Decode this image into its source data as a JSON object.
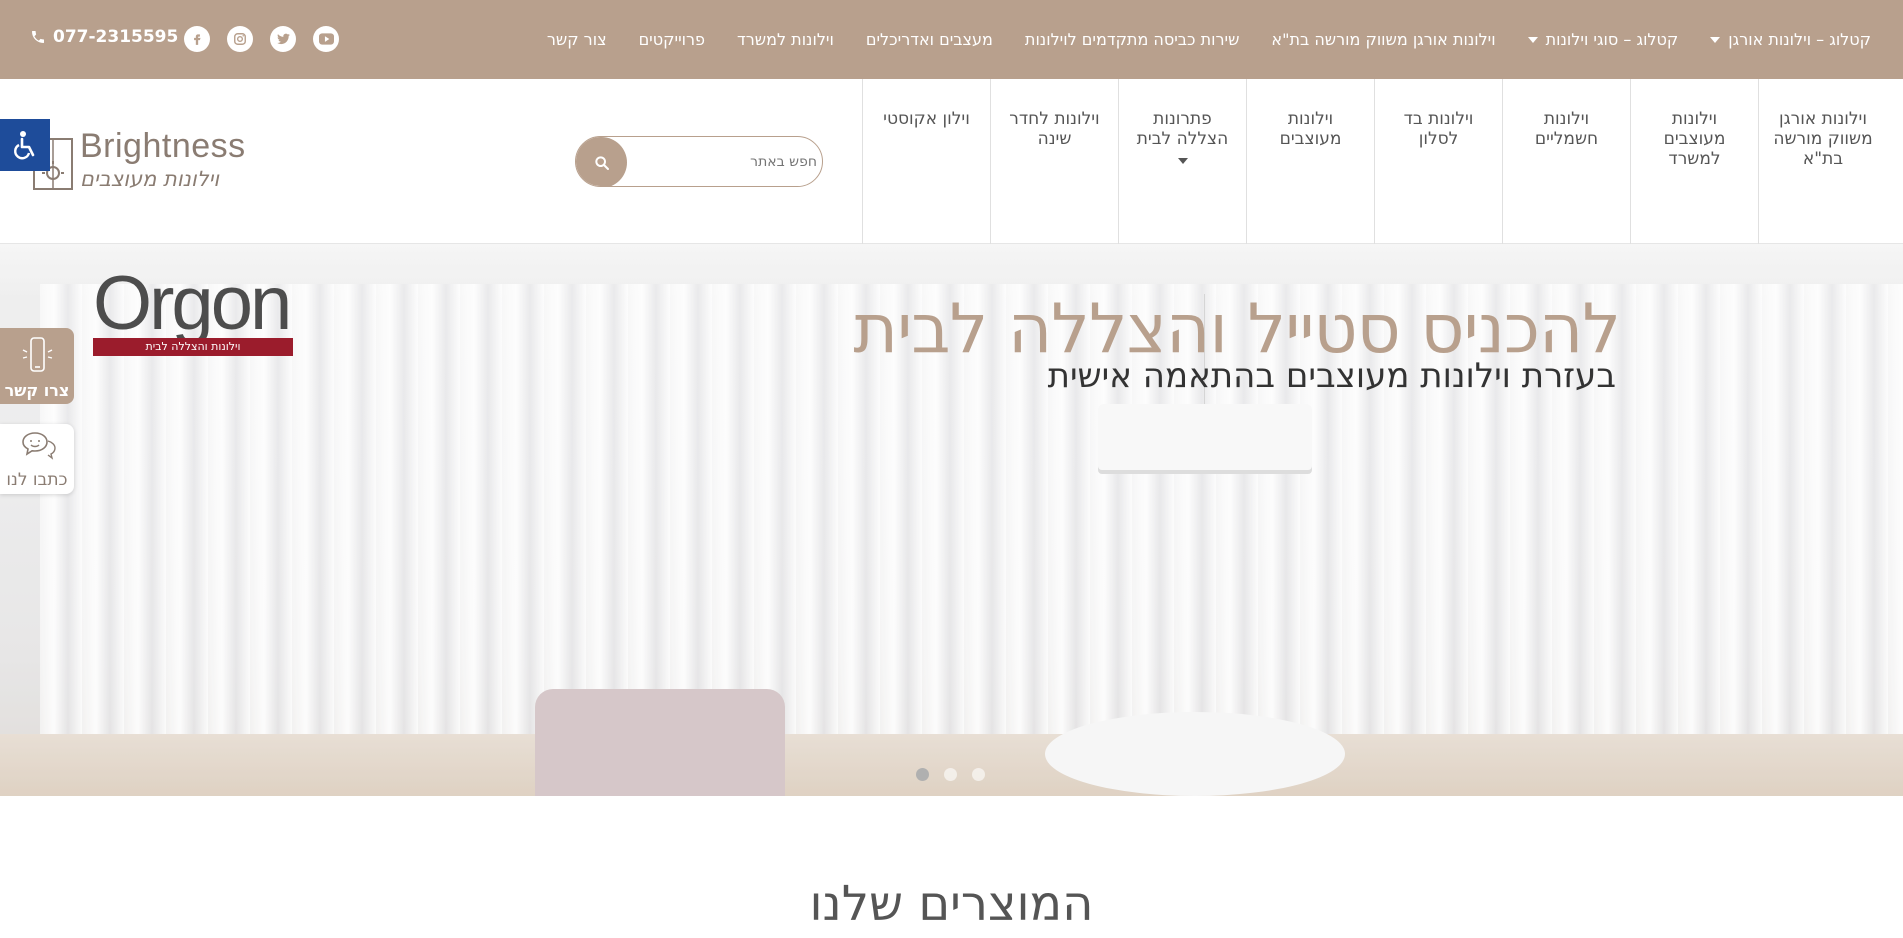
{
  "topbar": {
    "nav": [
      {
        "label": "קטלוג – וילונות אורגן",
        "has_dropdown": true
      },
      {
        "label": "קטלוג – סוגי וילונות",
        "has_dropdown": true
      },
      {
        "label": "וילונות אורגן משווק מורשה בת\"א",
        "has_dropdown": false
      },
      {
        "label": "שירות כביסה מתקדמים לוילונות",
        "has_dropdown": false
      },
      {
        "label": "מעצבים ואדריכלים",
        "has_dropdown": false
      },
      {
        "label": "וילונות למשרד",
        "has_dropdown": false
      },
      {
        "label": "פרוייקטים",
        "has_dropdown": false
      },
      {
        "label": "צור קשר",
        "has_dropdown": false
      }
    ],
    "social_icons": [
      "youtube-icon",
      "twitter-icon",
      "instagram-icon",
      "facebook-icon"
    ],
    "phone": "077-2315595"
  },
  "header": {
    "logo": {
      "wordmark": "Brightness",
      "tagline": "וילונות מעוצבים"
    },
    "search": {
      "placeholder": "חפש באתר"
    },
    "categories": [
      {
        "label": "וילונות אורגן משווק מורשה בת\"א",
        "has_dropdown": false
      },
      {
        "label": "וילונות מעוצבים למשרד",
        "has_dropdown": false
      },
      {
        "label": "וילונות חשמליים",
        "has_dropdown": false
      },
      {
        "label": "וילונות בד לסלון",
        "has_dropdown": false
      },
      {
        "label": "וילונות מעוצבים",
        "has_dropdown": false
      },
      {
        "label": "פתרונות הצללה לבית",
        "has_dropdown": true
      },
      {
        "label": "וילונות לחדר שינה",
        "has_dropdown": false
      },
      {
        "label": "וילון אקוסטי",
        "has_dropdown": false
      }
    ]
  },
  "hero": {
    "title": "להכניס סטייל והצללה לבית",
    "subtitle": "בעזרת וילונות מעוצבים בהתאמה אישית",
    "brand_logo": {
      "word": "Orgon",
      "band": "וילונות והצללה לבית"
    },
    "slides_count": 3,
    "active_slide": 1
  },
  "side_widgets": {
    "accessibility": "accessibility-icon",
    "contact_label": "צרו קשר",
    "write_label": "כתבו לנו"
  },
  "products": {
    "title": "המוצרים שלנו"
  },
  "colors": {
    "brand": "#b8a08d",
    "accessibility": "#1e4c9a",
    "orgon_band": "#9b1c2c"
  }
}
